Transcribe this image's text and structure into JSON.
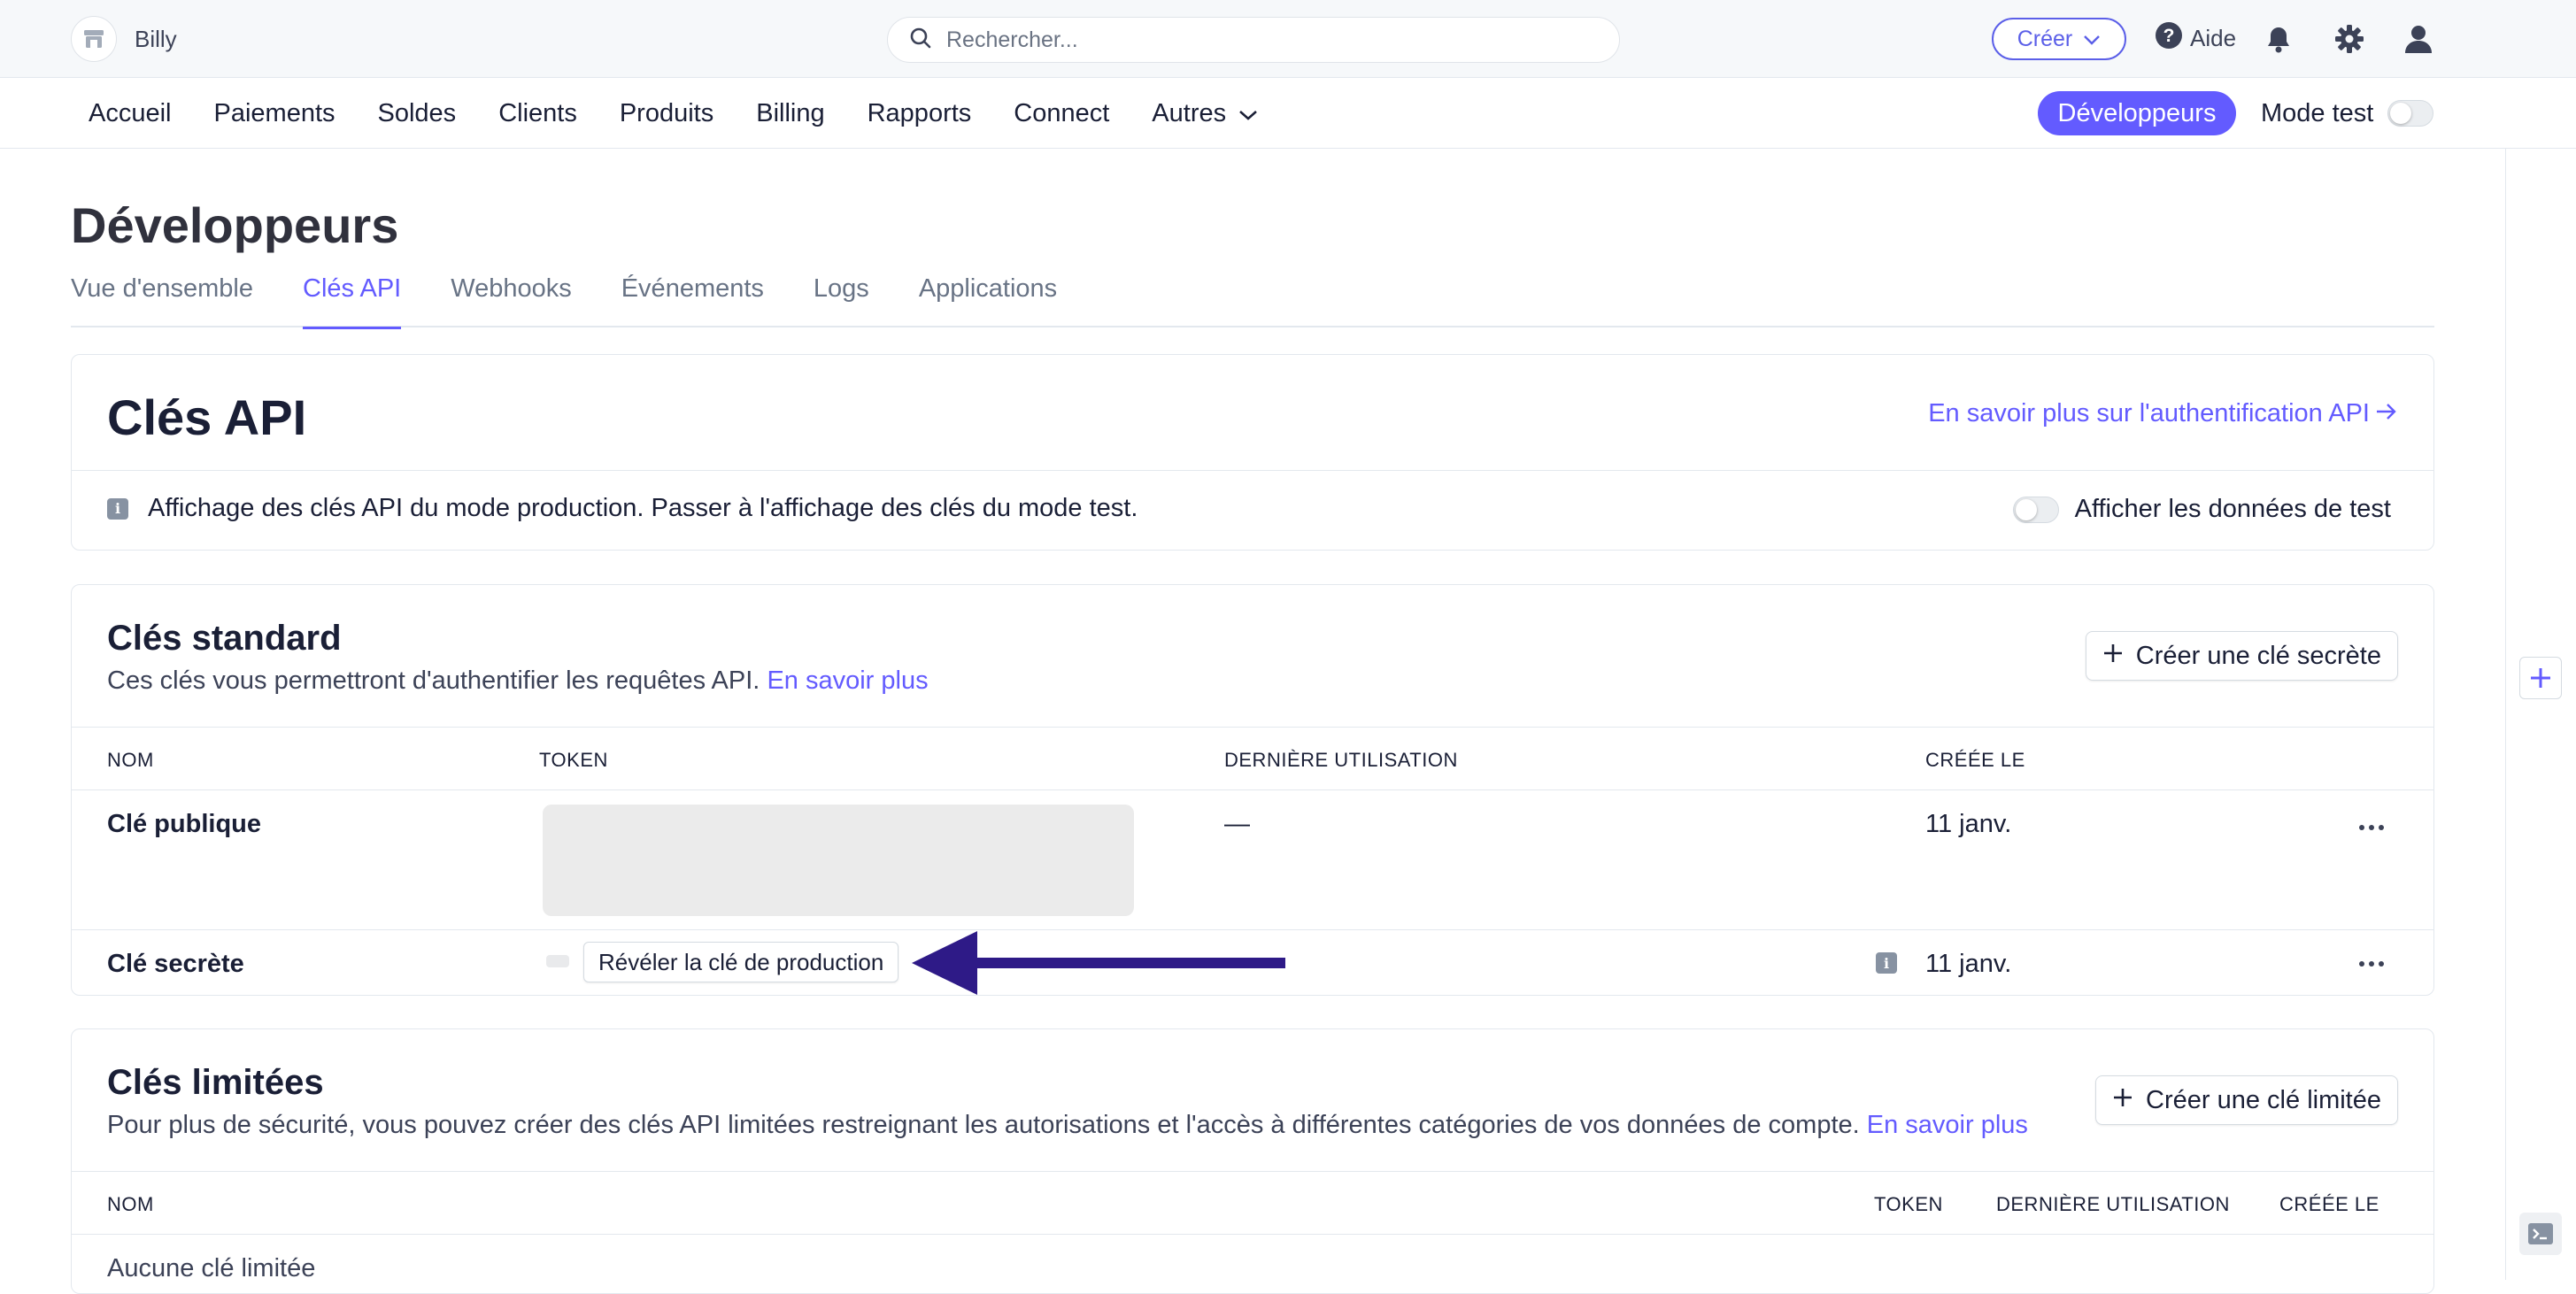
{
  "topbar": {
    "account_name": "Billy",
    "search_placeholder": "Rechercher...",
    "create_label": "Créer",
    "help_label": "Aide"
  },
  "nav": {
    "items": [
      "Accueil",
      "Paiements",
      "Soldes",
      "Clients",
      "Produits",
      "Billing",
      "Rapports",
      "Connect",
      "Autres"
    ],
    "developers_label": "Développeurs",
    "test_mode_label": "Mode test"
  },
  "page": {
    "title": "Développeurs",
    "tabs": [
      "Vue d'ensemble",
      "Clés API",
      "Webhooks",
      "Événements",
      "Logs",
      "Applications"
    ],
    "active_tab": "Clés API"
  },
  "api_keys_card": {
    "title": "Clés API",
    "learn_more_link": "En savoir plus sur l'authentification API",
    "info_text": "Affichage des clés API du mode production. Passer à l'affichage des clés du mode test.",
    "test_data_toggle_label": "Afficher les données de test"
  },
  "standard_keys": {
    "title": "Clés standard",
    "description": "Ces clés vous permettront d'authentifier les requêtes API.",
    "description_link": "En savoir plus",
    "create_button": "Créer une clé secrète",
    "columns": [
      "NOM",
      "TOKEN",
      "DERNIÈRE UTILISATION",
      "CRÉÉE LE"
    ],
    "rows": [
      {
        "name": "Clé publique",
        "last_used": "—",
        "created": "11 janv."
      },
      {
        "name": "Clé secrète",
        "reveal_button": "Révéler la clé de production",
        "created": "11 janv."
      }
    ]
  },
  "restricted_keys": {
    "title": "Clés limitées",
    "description": "Pour plus de sécurité, vous pouvez créer des clés API limitées restreignant les autorisations et l'accès à différentes catégories de vos données de compte.",
    "description_link": "En savoir plus",
    "create_button": "Créer une clé limitée",
    "columns": [
      "NOM",
      "TOKEN",
      "DERNIÈRE UTILISATION",
      "CRÉÉE LE"
    ],
    "empty_text": "Aucune clé limitée"
  },
  "colors": {
    "accent": "#635bff",
    "annotation_arrow": "#2e1a87"
  }
}
